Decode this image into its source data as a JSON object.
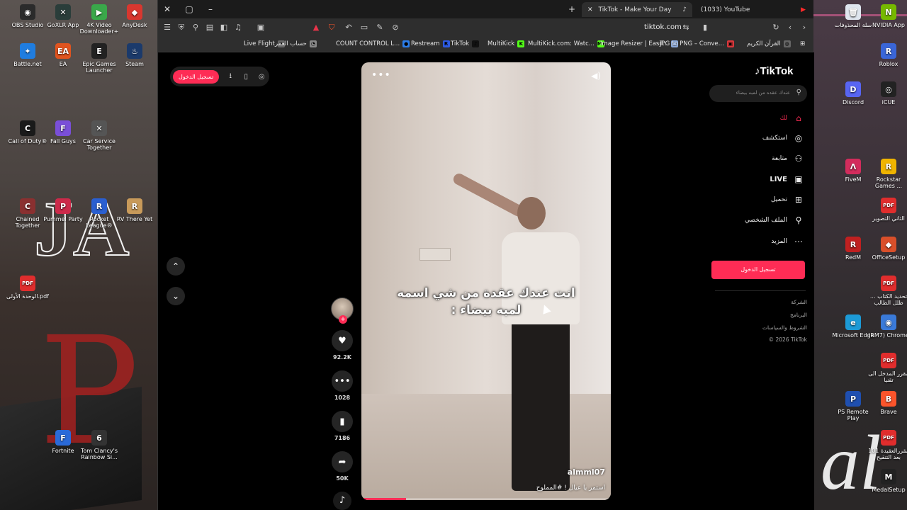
{
  "desktop": {
    "left_icons": [
      {
        "label": "OBS Studio",
        "color": "#2b2b2b",
        "glyph": "◉"
      },
      {
        "label": "GoXLR App",
        "color": "#2a3d3a",
        "glyph": "✕"
      },
      {
        "label": "4K Video Downloader+",
        "color": "#3aa84a",
        "glyph": "▶"
      },
      {
        "label": "AnyDesk",
        "color": "#d8372f",
        "glyph": "◆"
      },
      {
        "label": "Battle.net",
        "color": "#1f7de0",
        "glyph": "✦"
      },
      {
        "label": "EA",
        "color": "#e0541f",
        "glyph": "EA"
      },
      {
        "label": "Epic Games Launcher",
        "color": "#222222",
        "glyph": "E"
      },
      {
        "label": "Steam",
        "color": "#1b3a6b",
        "glyph": "♨"
      },
      {
        "label": "Call of Duty®",
        "color": "#1a1a1a",
        "glyph": "C"
      },
      {
        "label": "Fall Guys",
        "color": "#7a4fd8",
        "glyph": "F"
      },
      {
        "label": "Car Service Together",
        "color": "#555555",
        "glyph": "✕"
      },
      {
        "label": "Chained Together",
        "color": "#8a3030",
        "glyph": "C"
      },
      {
        "label": "Pummel Party",
        "color": "#cc2a4a",
        "glyph": "P"
      },
      {
        "label": "Rocket League®",
        "color": "#2a5fd0",
        "glyph": "R"
      },
      {
        "label": "RV There Yet",
        "color": "#c89a5a",
        "glyph": "R"
      },
      {
        "label": "الوحدة الأولى.pdf",
        "color": "#e02d2d",
        "glyph": "PDF"
      },
      {
        "label": "Fortnite",
        "color": "#2a6ad8",
        "glyph": "F"
      },
      {
        "label": "Tom Clancy's Rainbow Si...",
        "color": "#333333",
        "glyph": "6"
      }
    ],
    "right_icons": [
      {
        "label": "سلة المحذوفات",
        "color": "#dfe6ef",
        "glyph": "🗑"
      },
      {
        "label": "NVIDIA App",
        "color": "#76b900",
        "glyph": "N"
      },
      {
        "label": "Roblox",
        "color": "#3a66d8",
        "glyph": "R"
      },
      {
        "label": "Discord",
        "color": "#5865f2",
        "glyph": "D"
      },
      {
        "label": "iCUE",
        "color": "#222222",
        "glyph": "◎"
      },
      {
        "label": "FiveM",
        "color": "#d22c5c",
        "glyph": "Λ"
      },
      {
        "label": "Rockstar Games ...",
        "color": "#f0b400",
        "glyph": "R"
      },
      {
        "label": "الثاني التصوير",
        "color": "#e02d2d",
        "glyph": "PDF"
      },
      {
        "label": "RedM",
        "color": "#c02020",
        "glyph": "R"
      },
      {
        "label": "OfficeSetup",
        "color": "#d94f2a",
        "glyph": "◆"
      },
      {
        "label": "تحديد الكتاب ... ظلل الطالب",
        "color": "#e02d2d",
        "glyph": "PDF"
      },
      {
        "label": "Microsoft Edge",
        "color": "#1c9ad6",
        "glyph": "e"
      },
      {
        "label": "(RM7) Chrome",
        "color": "#3a7ad8",
        "glyph": "◉"
      },
      {
        "label": "مقرر المدخل الى تقنيا",
        "color": "#e02d2d",
        "glyph": "PDF"
      },
      {
        "label": "PS Remote Play",
        "color": "#1f4fb0",
        "glyph": "P"
      },
      {
        "label": "Brave",
        "color": "#fb542b",
        "glyph": "B"
      },
      {
        "label": "مقررالعقيدة 101 بعد التنقيح",
        "color": "#e02d2d",
        "glyph": "PDF"
      },
      {
        "label": "MedalSetup",
        "color": "#222222",
        "glyph": "M"
      }
    ]
  },
  "browser": {
    "tabs": [
      {
        "label": "TikTok - Make Your Day"
      },
      {
        "label": "(1033) YouTube"
      }
    ],
    "url": "tiktok.com",
    "bookmarks": [
      {
        "label": "Live Flight",
        "color": "#666666",
        "glyph": "✈"
      },
      {
        "label": "حساب العمر",
        "color": "#888888",
        "glyph": "◔"
      },
      {
        "label": "COUNT CONTROL L...",
        "color": "#2b7de9",
        "glyph": "●"
      },
      {
        "label": "Restream",
        "color": "#2d5be3",
        "glyph": "R"
      },
      {
        "label": "TikTok",
        "color": "#111111",
        "glyph": "♪"
      },
      {
        "label": "MultiKick",
        "color": "#53fc18",
        "glyph": "K"
      },
      {
        "label": "MultiKick.com: Watc...",
        "color": "#53fc18",
        "glyph": "MK"
      },
      {
        "label": "Image Resizer | Easil...",
        "color": "#8aa8d8",
        "glyph": "▢"
      },
      {
        "label": "JPG to PNG – Conve...",
        "color": "#d8373b",
        "glyph": "▣"
      },
      {
        "label": "القرآن الكريم",
        "color": "#666666",
        "glyph": "◍"
      }
    ]
  },
  "tiktok": {
    "brand": "TikTok",
    "top_login": "تسجيل الدخول",
    "search_placeholder": "عندك عقده من لمبه بيضاء",
    "nav": [
      {
        "label": "لك",
        "icon": "home-icon",
        "glyph": "⌂",
        "active": true
      },
      {
        "label": "استكشف",
        "icon": "compass-icon",
        "glyph": "◎",
        "active": false
      },
      {
        "label": "متابعة",
        "icon": "following-icon",
        "glyph": "⚇",
        "active": false
      },
      {
        "label": "LIVE",
        "icon": "live-icon",
        "glyph": "▣",
        "active": false
      },
      {
        "label": "تحميل",
        "icon": "upload-icon",
        "glyph": "⊞",
        "active": false
      },
      {
        "label": "الملف الشخصي",
        "icon": "profile-icon",
        "glyph": "⚲",
        "active": false
      },
      {
        "label": "المزيد",
        "icon": "more-icon",
        "glyph": "⋯",
        "active": false
      }
    ],
    "sidebar_login": "تسجيل الدخول",
    "footer": [
      "الشركة",
      "البرنامج",
      "الشروط والسياسات",
      "© 2026 TikTok"
    ],
    "video": {
      "caption": "انت عندك عقدة من شي اسمه لمبه بيضاء :",
      "author": "almml07",
      "description": "استمر يا عيال ! #المملوح",
      "progress": 0.18
    },
    "stats": {
      "likes": "92.2K",
      "comments": "1028",
      "saves": "7186",
      "shares": "50K"
    }
  }
}
